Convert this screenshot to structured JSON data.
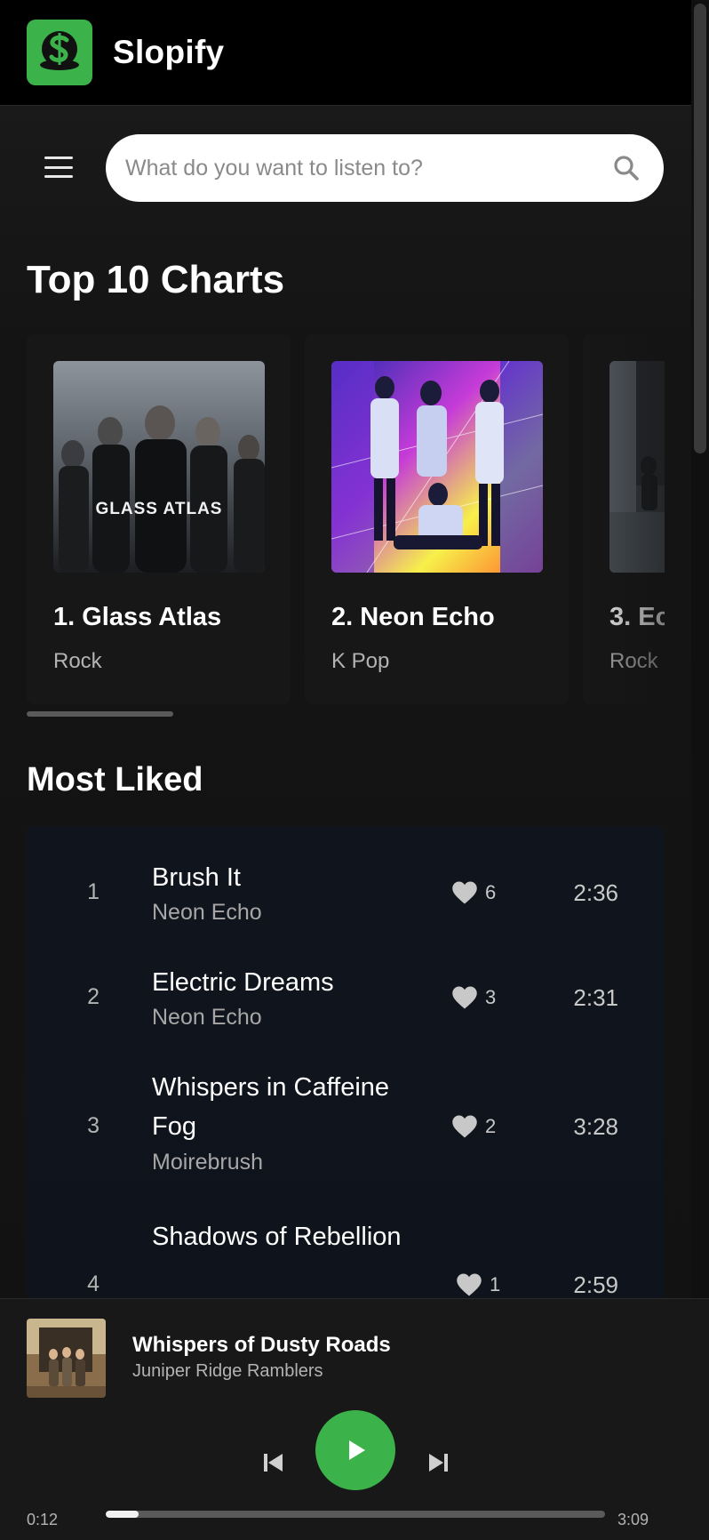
{
  "app": {
    "brand": "Slopify"
  },
  "search": {
    "placeholder": "What do you want to listen to?"
  },
  "sections": {
    "top_charts": "Top 10 Charts",
    "most_liked": "Most Liked"
  },
  "charts": [
    {
      "name": "1. Glass Atlas",
      "genre": "Rock",
      "art_text": "GLASS ATLAS"
    },
    {
      "name": "2. Neon Echo",
      "genre": "K Pop"
    },
    {
      "name": "3. Ec",
      "genre": "Rock"
    }
  ],
  "most_liked": [
    {
      "rank": "1",
      "title": "Brush It",
      "artist": "Neon Echo",
      "likes": "6",
      "duration": "2:36"
    },
    {
      "rank": "2",
      "title": "Electric Dreams",
      "artist": "Neon Echo",
      "likes": "3",
      "duration": "2:31"
    },
    {
      "rank": "3",
      "title": "Whispers in Caffeine Fog",
      "artist": "Moirebrush",
      "likes": "2",
      "duration": "3:28"
    },
    {
      "rank": "4",
      "title": "Shadows of Rebellion",
      "artist": "",
      "likes": "1",
      "duration": "2:59"
    }
  ],
  "player": {
    "title": "Whispers of Dusty Roads",
    "artist": "Juniper Ridge Ramblers",
    "current_time": "0:12",
    "total_time": "3:09",
    "progress": 0.065
  },
  "colors": {
    "accent": "#3cb34a",
    "background": "#121212",
    "list_bg": "#10141c"
  },
  "icons": [
    "slopify-logo-icon",
    "menu-icon",
    "search-icon",
    "heart-icon",
    "skip-previous-icon",
    "play-icon",
    "skip-next-icon"
  ]
}
